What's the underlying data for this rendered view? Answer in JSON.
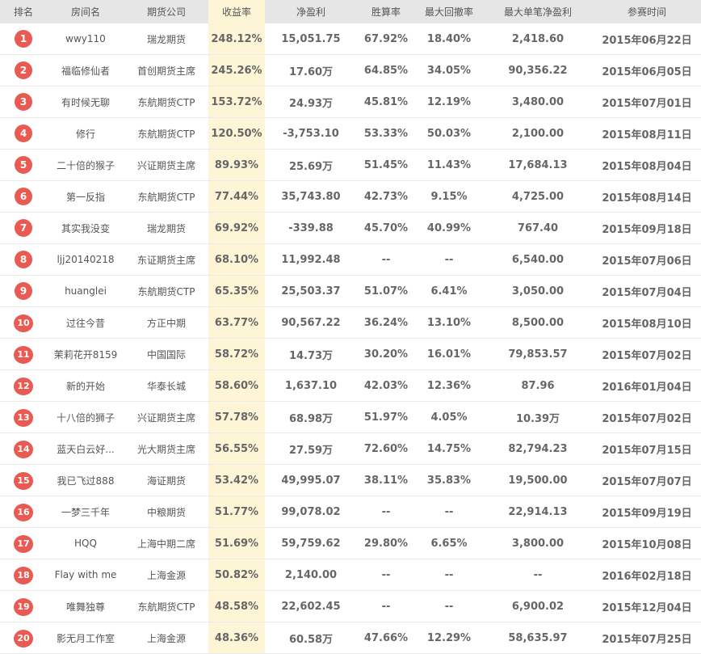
{
  "headers": [
    "排名",
    "房间名",
    "期货公司",
    "收益率",
    "净盈利",
    "胜算率",
    "最大回撤率",
    "最大单笔净盈利",
    "参赛时间"
  ],
  "rows": [
    {
      "rank": "1",
      "room": "wwy110",
      "company": "瑞龙期货",
      "rate": "248.12%",
      "profit": "15,051.75",
      "win": "67.92%",
      "drawdown": "18.40%",
      "max_single": "2,418.60",
      "date": "2015年06月22日"
    },
    {
      "rank": "2",
      "room": "福临修仙者",
      "company": "首创期货主席",
      "rate": "245.26%",
      "profit": "17.60万",
      "win": "64.85%",
      "drawdown": "34.05%",
      "max_single": "90,356.22",
      "date": "2015年06月05日"
    },
    {
      "rank": "3",
      "room": "有时候无聊",
      "company": "东航期货CTP",
      "rate": "153.72%",
      "profit": "24.93万",
      "win": "45.81%",
      "drawdown": "12.19%",
      "max_single": "3,480.00",
      "date": "2015年07月01日"
    },
    {
      "rank": "4",
      "room": "修行",
      "company": "东航期货CTP",
      "rate": "120.50%",
      "profit": "-3,753.10",
      "win": "53.33%",
      "drawdown": "50.03%",
      "max_single": "2,100.00",
      "date": "2015年08月11日"
    },
    {
      "rank": "5",
      "room": "二十倍的猴子",
      "company": "兴证期货主席",
      "rate": "89.93%",
      "profit": "25.69万",
      "win": "51.45%",
      "drawdown": "11.43%",
      "max_single": "17,684.13",
      "date": "2015年08月04日"
    },
    {
      "rank": "6",
      "room": "第一反指",
      "company": "东航期货CTP",
      "rate": "77.44%",
      "profit": "35,743.80",
      "win": "42.73%",
      "drawdown": "9.15%",
      "max_single": "4,725.00",
      "date": "2015年08月14日"
    },
    {
      "rank": "7",
      "room": "其实我没变",
      "company": "瑞龙期货",
      "rate": "69.92%",
      "profit": "-339.88",
      "win": "45.70%",
      "drawdown": "40.99%",
      "max_single": "767.40",
      "date": "2015年09月18日"
    },
    {
      "rank": "8",
      "room": "ljj20140218",
      "company": "东证期货主席",
      "rate": "68.10%",
      "profit": "11,992.48",
      "win": "--",
      "drawdown": "--",
      "max_single": "6,540.00",
      "date": "2015年07月06日"
    },
    {
      "rank": "9",
      "room": "huanglei",
      "company": "东航期货CTP",
      "rate": "65.35%",
      "profit": "25,503.37",
      "win": "51.07%",
      "drawdown": "6.41%",
      "max_single": "3,050.00",
      "date": "2015年07月04日"
    },
    {
      "rank": "10",
      "room": "过往今昔",
      "company": "方正中期",
      "rate": "63.77%",
      "profit": "90,567.22",
      "win": "36.24%",
      "drawdown": "13.10%",
      "max_single": "8,500.00",
      "date": "2015年08月10日"
    },
    {
      "rank": "11",
      "room": "茉莉花开8159",
      "company": "中国国际",
      "rate": "58.72%",
      "profit": "14.73万",
      "win": "30.20%",
      "drawdown": "16.01%",
      "max_single": "79,853.57",
      "date": "2015年07月02日"
    },
    {
      "rank": "12",
      "room": "新的开始",
      "company": "华泰长城",
      "rate": "58.60%",
      "profit": "1,637.10",
      "win": "42.03%",
      "drawdown": "12.36%",
      "max_single": "87.96",
      "date": "2016年01月04日"
    },
    {
      "rank": "13",
      "room": "十八倍的狮子",
      "company": "兴证期货主席",
      "rate": "57.78%",
      "profit": "68.98万",
      "win": "51.97%",
      "drawdown": "4.05%",
      "max_single": "10.39万",
      "date": "2015年07月02日"
    },
    {
      "rank": "14",
      "room": "蓝天白云好...",
      "company": "光大期货主席",
      "rate": "56.55%",
      "profit": "27.59万",
      "win": "72.60%",
      "drawdown": "14.75%",
      "max_single": "82,794.23",
      "date": "2015年07月15日"
    },
    {
      "rank": "15",
      "room": "我已飞过888",
      "company": "海证期货",
      "rate": "53.42%",
      "profit": "49,995.07",
      "win": "38.11%",
      "drawdown": "35.83%",
      "max_single": "19,500.00",
      "date": "2015年07月07日"
    },
    {
      "rank": "16",
      "room": "一梦三千年",
      "company": "中粮期货",
      "rate": "51.77%",
      "profit": "99,078.02",
      "win": "--",
      "drawdown": "--",
      "max_single": "22,914.13",
      "date": "2015年09月19日"
    },
    {
      "rank": "17",
      "room": "HQQ",
      "company": "上海中期二席",
      "rate": "51.69%",
      "profit": "59,759.62",
      "win": "29.80%",
      "drawdown": "6.65%",
      "max_single": "3,800.00",
      "date": "2015年10月08日"
    },
    {
      "rank": "18",
      "room": "Flay with me",
      "company": "上海金源",
      "rate": "50.82%",
      "profit": "2,140.00",
      "win": "--",
      "drawdown": "--",
      "max_single": "--",
      "date": "2016年02月18日"
    },
    {
      "rank": "19",
      "room": "唯舞独尊",
      "company": "东航期货CTP",
      "rate": "48.58%",
      "profit": "22,602.45",
      "win": "--",
      "drawdown": "--",
      "max_single": "6,900.02",
      "date": "2015年12月04日"
    },
    {
      "rank": "20",
      "room": "影无月工作室",
      "company": "上海金源",
      "rate": "48.36%",
      "profit": "60.58万",
      "win": "47.66%",
      "drawdown": "12.29%",
      "max_single": "58,635.97",
      "date": "2015年07月25日"
    }
  ],
  "colors": {
    "badge": "#e85a52",
    "rate_highlight": "#fdf5d6",
    "header_bg": "#e6e6e6"
  }
}
